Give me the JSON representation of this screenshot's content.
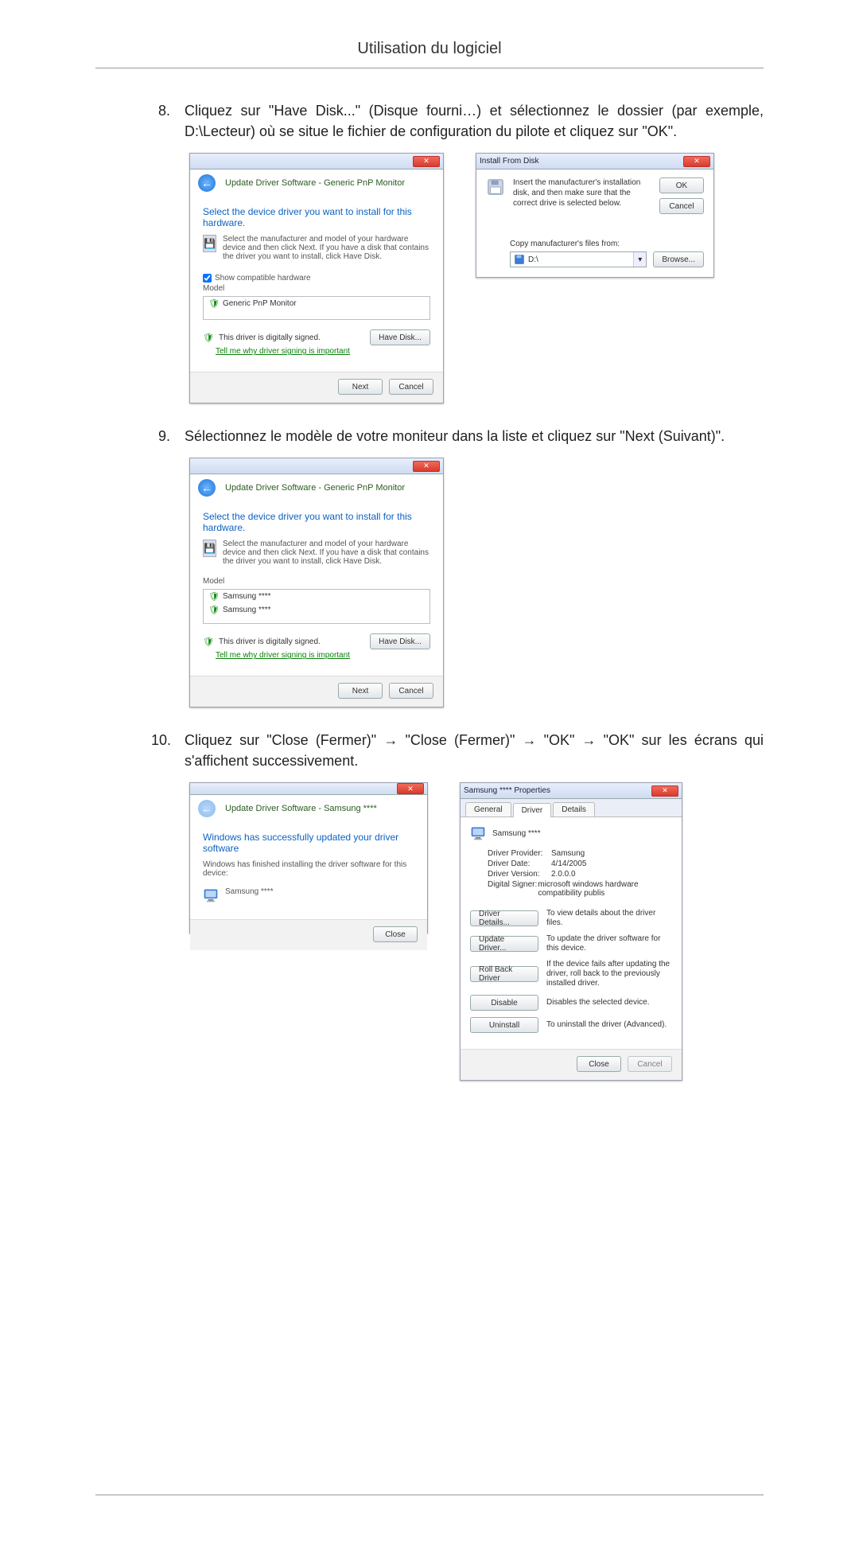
{
  "header": {
    "title": "Utilisation du logiciel"
  },
  "steps": {
    "s8": {
      "num": "8.",
      "text": "Cliquez sur \"Have Disk...\" (Disque fourni…) et sélectionnez le dossier (par exemple, D:\\Lecteur) où se situe le fichier de configuration du pilote et cliquez sur \"OK\"."
    },
    "s9": {
      "num": "9.",
      "text": "Sélectionnez le modèle de votre moniteur dans la liste et cliquez sur \"Next (Suivant)\"."
    },
    "s10": {
      "num": "10.",
      "text": "Cliquez sur \"Close (Fermer)\" → \"Close (Fermer)\" → \"OK\" → \"OK\" sur les écrans qui s'affichent successivement."
    }
  },
  "common": {
    "close_glyph": "✕",
    "arrow_glyph": "←",
    "dropdown_glyph": "▾"
  },
  "win_update1": {
    "crumb": "Update Driver Software - Generic PnP Monitor",
    "heading": "Select the device driver you want to install for this hardware.",
    "desc": "Select the manufacturer and model of your hardware device and then click Next. If you have a disk that contains the driver you want to install, click Have Disk.",
    "show_compat": "Show compatible hardware",
    "model_hdr": "Model",
    "model_item": "Generic PnP Monitor",
    "signed": "This driver is digitally signed.",
    "tellme": "Tell me why driver signing is important",
    "have_disk_btn": "Have Disk...",
    "next_btn": "Next",
    "cancel_btn": "Cancel"
  },
  "win_ifd": {
    "title": "Install From Disk",
    "text": "Insert the manufacturer's installation disk, and then make sure that the correct drive is selected below.",
    "ok_btn": "OK",
    "cancel_btn": "Cancel",
    "copy_label": "Copy manufacturer's files from:",
    "selected": "D:\\",
    "browse_btn": "Browse..."
  },
  "win_update2": {
    "crumb": "Update Driver Software - Generic PnP Monitor",
    "heading": "Select the device driver you want to install for this hardware.",
    "desc": "Select the manufacturer and model of your hardware device and then click Next. If you have a disk that contains the driver you want to install, click Have Disk.",
    "model_hdr": "Model",
    "model_item1": "Samsung ****",
    "model_item2": "Samsung ****",
    "signed": "This driver is digitally signed.",
    "tellme": "Tell me why driver signing is important",
    "have_disk_btn": "Have Disk...",
    "next_btn": "Next",
    "cancel_btn": "Cancel"
  },
  "win_success": {
    "crumb": "Update Driver Software - Samsung ****",
    "heading": "Windows has successfully updated your driver software",
    "desc": "Windows has finished installing the driver software for this device:",
    "device": "Samsung ****",
    "close_btn": "Close"
  },
  "win_props": {
    "title": "Samsung **** Properties",
    "tab_general": "General",
    "tab_driver": "Driver",
    "tab_details": "Details",
    "device": "Samsung ****",
    "provider_k": "Driver Provider:",
    "provider_v": "Samsung",
    "date_k": "Driver Date:",
    "date_v": "4/14/2005",
    "ver_k": "Driver Version:",
    "ver_v": "2.0.0.0",
    "signer_k": "Digital Signer:",
    "signer_v": "microsoft windows hardware compatibility publis",
    "btn_details": "Driver Details...",
    "btn_details_desc": "To view details about the driver files.",
    "btn_update": "Update Driver...",
    "btn_update_desc": "To update the driver software for this device.",
    "btn_rollback": "Roll Back Driver",
    "btn_rollback_desc": "If the device fails after updating the driver, roll back to the previously installed driver.",
    "btn_disable": "Disable",
    "btn_disable_desc": "Disables the selected device.",
    "btn_uninstall": "Uninstall",
    "btn_uninstall_desc": "To uninstall the driver (Advanced).",
    "close_btn": "Close",
    "cancel_btn": "Cancel"
  }
}
